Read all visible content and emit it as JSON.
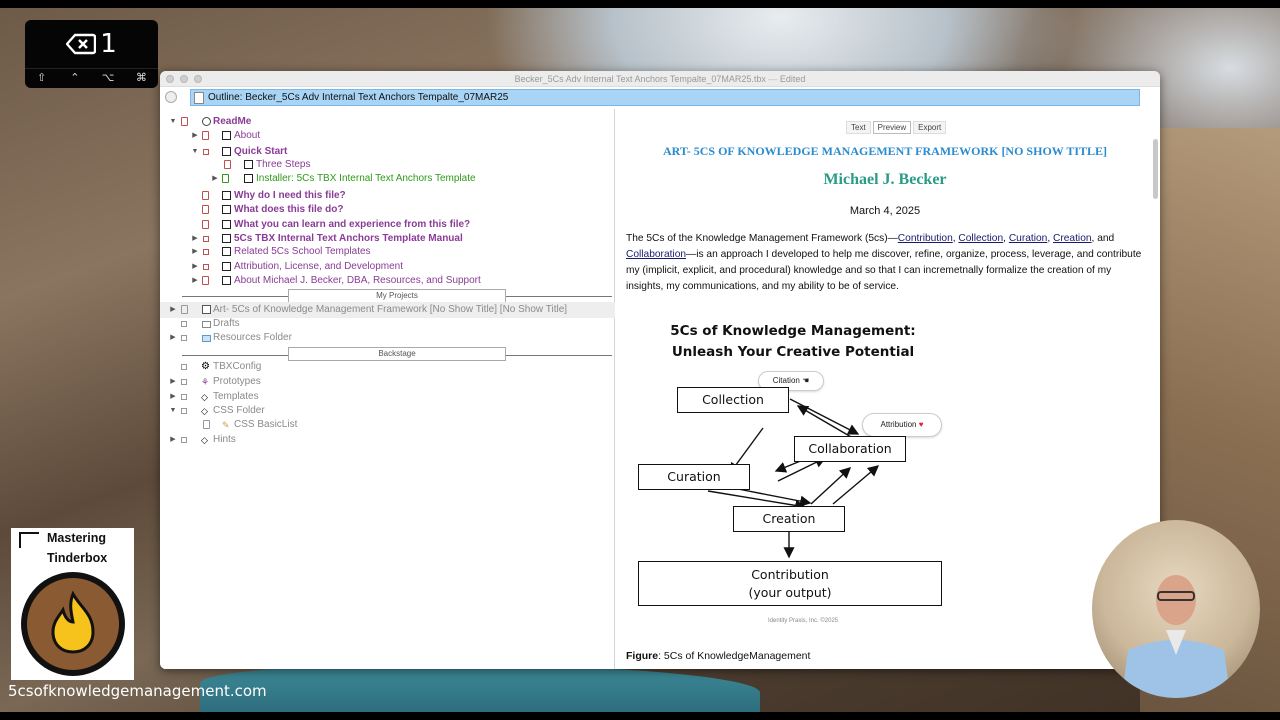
{
  "keystroke": {
    "main": "1",
    "mods": [
      "⇧",
      "⌃",
      "⌥",
      "⌘"
    ]
  },
  "window": {
    "title": "Becker_5Cs Adv Internal Text Anchors Tempalte_07MAR25.tbx",
    "title_suffix": "Edited",
    "outline_path": "Outline: Becker_5Cs Adv Internal Text Anchors Tempalte_07MAR25"
  },
  "outline": {
    "readme": "ReadMe",
    "about": "About",
    "quick_start": "Quick Start",
    "three_steps": "Three Steps",
    "installer": "Installer: 5Cs TBX Internal Text Anchors Template",
    "why": "Why do I need this file?",
    "what_do": "What does this file do?",
    "what_learn": "What you can learn and experience from this file?",
    "manual": "5Cs TBX Internal Text Anchors Template Manual",
    "related": "Related 5Cs School Templates",
    "attribution": "Attribution, License, and Development",
    "about_becker": "About Michael J. Becker, DBA, Resources, and Support",
    "sep_projects": "My Projects",
    "art": "Art- 5Cs of Knowledge Management Framework [No Show Title] [No Show Title]",
    "drafts": "Drafts",
    "resources": "Resources Folder",
    "sep_backstage": "Backstage",
    "tbxconfig": "TBXConfig",
    "prototypes": "Prototypes",
    "templates": "Templates",
    "css_folder": "CSS Folder",
    "css_basic": "CSS BasicList",
    "hints": "Hints"
  },
  "preview": {
    "tabs": [
      "Text",
      "Preview",
      "Export"
    ],
    "title": "ART- 5CS OF KNOWLEDGE MANAGEMENT FRAMEWORK [NO SHOW TITLE]",
    "author": "Michael J. Becker",
    "date": "March 4, 2025",
    "body_intro": "The 5Cs of the Knowledge Management Framework (5cs)—",
    "links": [
      "Contribution",
      "Collection",
      "Curation",
      "Creation",
      "Collaboration"
    ],
    "sep_comma": ", ",
    "sep_and": ", and",
    "body_rest": "—is an approach I developed to help me discover, refine, organize, process, leverage, and contribute my (implicit, explicit, and procedural) knowledge and so that I can incremetnally formalize the creation of my insights, my communications, and my ability to be of service.",
    "caption_label": "Figure",
    "caption_text": ": 5Cs of KnowledgeManagement"
  },
  "diagram": {
    "title_line1": "5Cs of Knowledge Management:",
    "title_line2": "Unleash Your Creative Potential",
    "collection": "Collection",
    "curation": "Curation",
    "collaboration": "Collaboration",
    "creation": "Creation",
    "contribution_line1": "Contribution",
    "contribution_line2": "(your output)",
    "pill_citation": "Citation",
    "pill_attribution": "Attribution",
    "credit": "Identity Praxis, Inc. ©2025"
  },
  "branding": {
    "line1": "Mastering",
    "line2": "Tinderbox",
    "url": "5csofknowledgemanagement.com"
  },
  "colors": {
    "title_blue": "#2a8ccf",
    "author_teal": "#2a9b88",
    "outline_purple": "#8a3c96",
    "outline_green": "#2f9a1a",
    "path_highlight": "#a8d4f6"
  }
}
